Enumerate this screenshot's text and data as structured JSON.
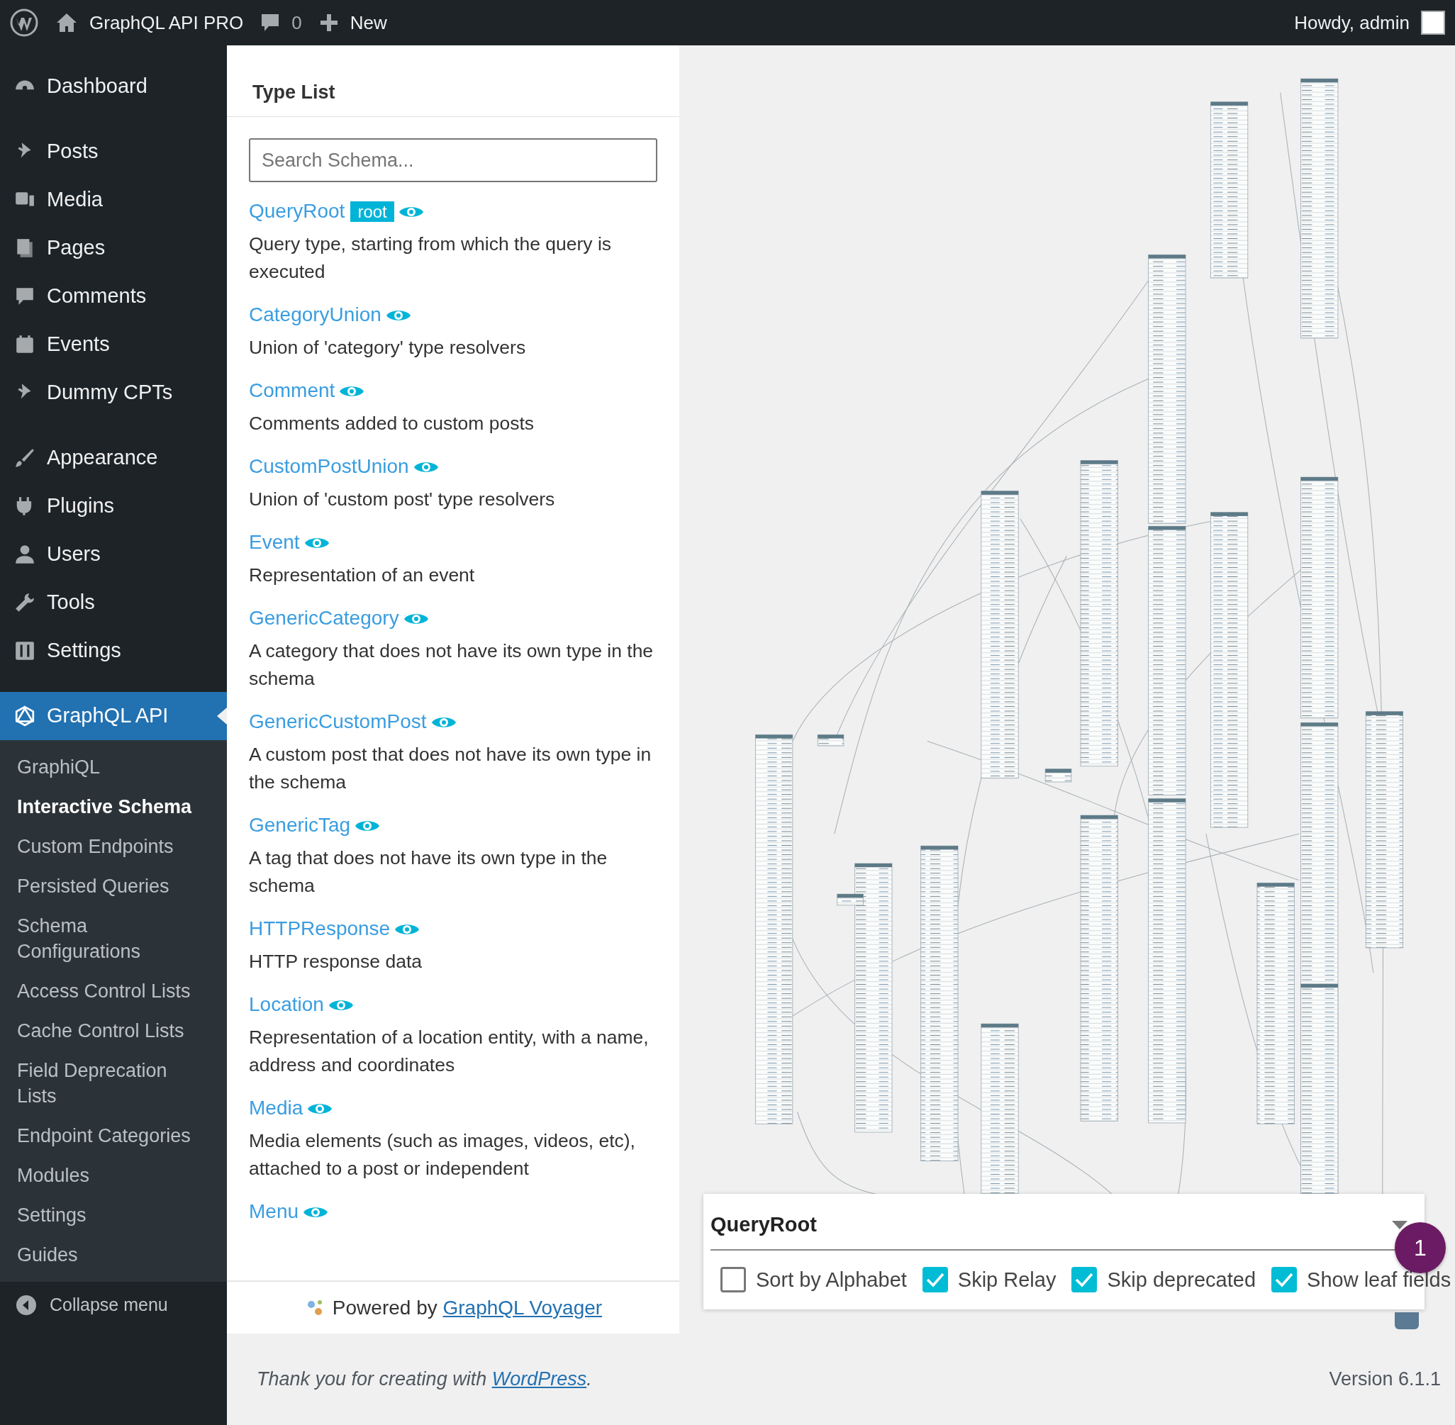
{
  "admin_bar": {
    "site_name": "GraphQL API PRO",
    "comments_count": "0",
    "new_label": "New",
    "greeting": "Howdy, admin"
  },
  "sidebar": {
    "menu_groups": [
      [
        {
          "label": "Dashboard",
          "selected": false
        }
      ],
      [
        {
          "label": "Posts",
          "selected": false
        },
        {
          "label": "Media",
          "selected": false
        },
        {
          "label": "Pages",
          "selected": false
        },
        {
          "label": "Comments",
          "selected": false
        },
        {
          "label": "Events",
          "selected": false
        },
        {
          "label": "Dummy CPTs",
          "selected": false
        }
      ],
      [
        {
          "label": "Appearance",
          "selected": false
        },
        {
          "label": "Plugins",
          "selected": false
        },
        {
          "label": "Users",
          "selected": false
        },
        {
          "label": "Tools",
          "selected": false
        },
        {
          "label": "Settings",
          "selected": false
        }
      ],
      [
        {
          "label": "GraphQL API",
          "selected": true,
          "children": [
            {
              "label": "GraphiQL",
              "selected": false
            },
            {
              "label": "Interactive Schema",
              "selected": true
            },
            {
              "label": "Custom Endpoints",
              "selected": false
            },
            {
              "label": "Persisted Queries",
              "selected": false
            },
            {
              "label": "Schema Configurations",
              "selected": false
            },
            {
              "label": "Access Control Lists",
              "selected": false
            },
            {
              "label": "Cache Control Lists",
              "selected": false
            },
            {
              "label": "Field Deprecation Lists",
              "selected": false
            },
            {
              "label": "Endpoint Categories",
              "selected": false
            },
            {
              "label": "Modules",
              "selected": false
            },
            {
              "label": "Settings",
              "selected": false
            },
            {
              "label": "Guides",
              "selected": false
            }
          ]
        }
      ]
    ],
    "collapse_label": "Collapse menu"
  },
  "type_list": {
    "title": "Type List",
    "search": {
      "placeholder": "Search Schema..."
    },
    "types": [
      {
        "name": "QueryRoot",
        "badge": "root",
        "description": "Query type, starting from which the query is executed"
      },
      {
        "name": "CategoryUnion",
        "description": "Union of 'category' type resolvers"
      },
      {
        "name": "Comment",
        "description": "Comments added to custom posts"
      },
      {
        "name": "CustomPostUnion",
        "description": "Union of 'custom post' type resolvers"
      },
      {
        "name": "Event",
        "description": "Representation of an event"
      },
      {
        "name": "GenericCategory",
        "description": "A category that does not have its own type in the schema"
      },
      {
        "name": "GenericCustomPost",
        "description": "A custom post that does not have its own type in the schema"
      },
      {
        "name": "GenericTag",
        "description": "A tag that does not have its own type in the schema"
      },
      {
        "name": "HTTPResponse",
        "description": "HTTP response data"
      },
      {
        "name": "Location",
        "description": "Representation of a location entity, with a name, address and coordinates"
      },
      {
        "name": "Media",
        "description": "Media elements (such as images, videos, etc), attached to a post or independent"
      },
      {
        "name": "Menu"
      }
    ],
    "powered_by": {
      "text": "Powered by",
      "link": "GraphQL Voyager"
    }
  },
  "settings_panel": {
    "root_type": "QueryRoot",
    "options": [
      {
        "label": "Sort by Alphabet",
        "checked": false
      },
      {
        "label": "Skip Relay",
        "checked": true
      },
      {
        "label": "Skip deprecated",
        "checked": true
      },
      {
        "label": "Show leaf fields",
        "checked": true
      }
    ],
    "notification_count": "1"
  },
  "footer": {
    "text": "Thank you for creating with",
    "link": "WordPress",
    "end": ".",
    "version": "Version 6.1.1"
  }
}
